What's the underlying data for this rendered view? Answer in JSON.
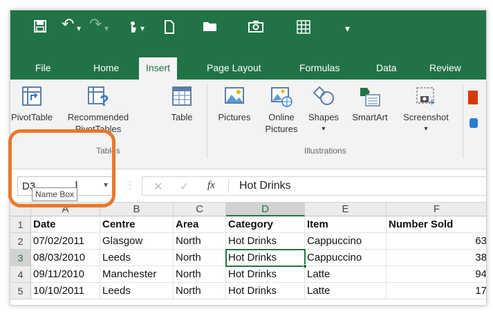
{
  "quick_access": {
    "undo": "↶",
    "redo": "↷",
    "dropdown": "▾"
  },
  "tabs": [
    {
      "label": "File"
    },
    {
      "label": "Home"
    },
    {
      "label": "Insert"
    },
    {
      "label": "Page Layout"
    },
    {
      "label": "Formulas"
    },
    {
      "label": "Data"
    },
    {
      "label": "Review"
    }
  ],
  "ribbon": {
    "pivottable": "PivotTable",
    "recommended": "Recommended",
    "pivottables": "PivotTables",
    "table": "Table",
    "tables_group": "Tables",
    "pictures": "Pictures",
    "online": "Online",
    "online_pictures": "Pictures",
    "shapes": "Shapes",
    "smartart": "SmartArt",
    "screenshot": "Screenshot",
    "illustrations_group": "Illustrations"
  },
  "formula_bar": {
    "name_box": "D3",
    "cancel": "✕",
    "enter": "✓",
    "fx": "fx",
    "formula": "Hot Drinks",
    "tooltip": "Name Box"
  },
  "columns": [
    "A",
    "B",
    "C",
    "D",
    "E",
    "F"
  ],
  "rows": [
    {
      "num": "1",
      "cells": [
        "Date",
        "Centre",
        "Area",
        "Category",
        "Item",
        "Number Sold"
      ]
    },
    {
      "num": "2",
      "cells": [
        "07/02/2011",
        "Glasgow",
        "North",
        "Hot Drinks",
        "Cappuccino",
        "63"
      ]
    },
    {
      "num": "3",
      "cells": [
        "08/03/2010",
        "Leeds",
        "North",
        "Hot Drinks",
        "Cappuccino",
        "38"
      ]
    },
    {
      "num": "4",
      "cells": [
        "09/11/2010",
        "Manchester",
        "North",
        "Hot Drinks",
        "Latte",
        "94"
      ]
    },
    {
      "num": "5",
      "cells": [
        "10/10/2011",
        "Leeds",
        "North",
        "Hot Drinks",
        "Latte",
        "17"
      ]
    }
  ],
  "colors": {
    "excel_green": "#217346",
    "highlight": "#e8782c"
  }
}
